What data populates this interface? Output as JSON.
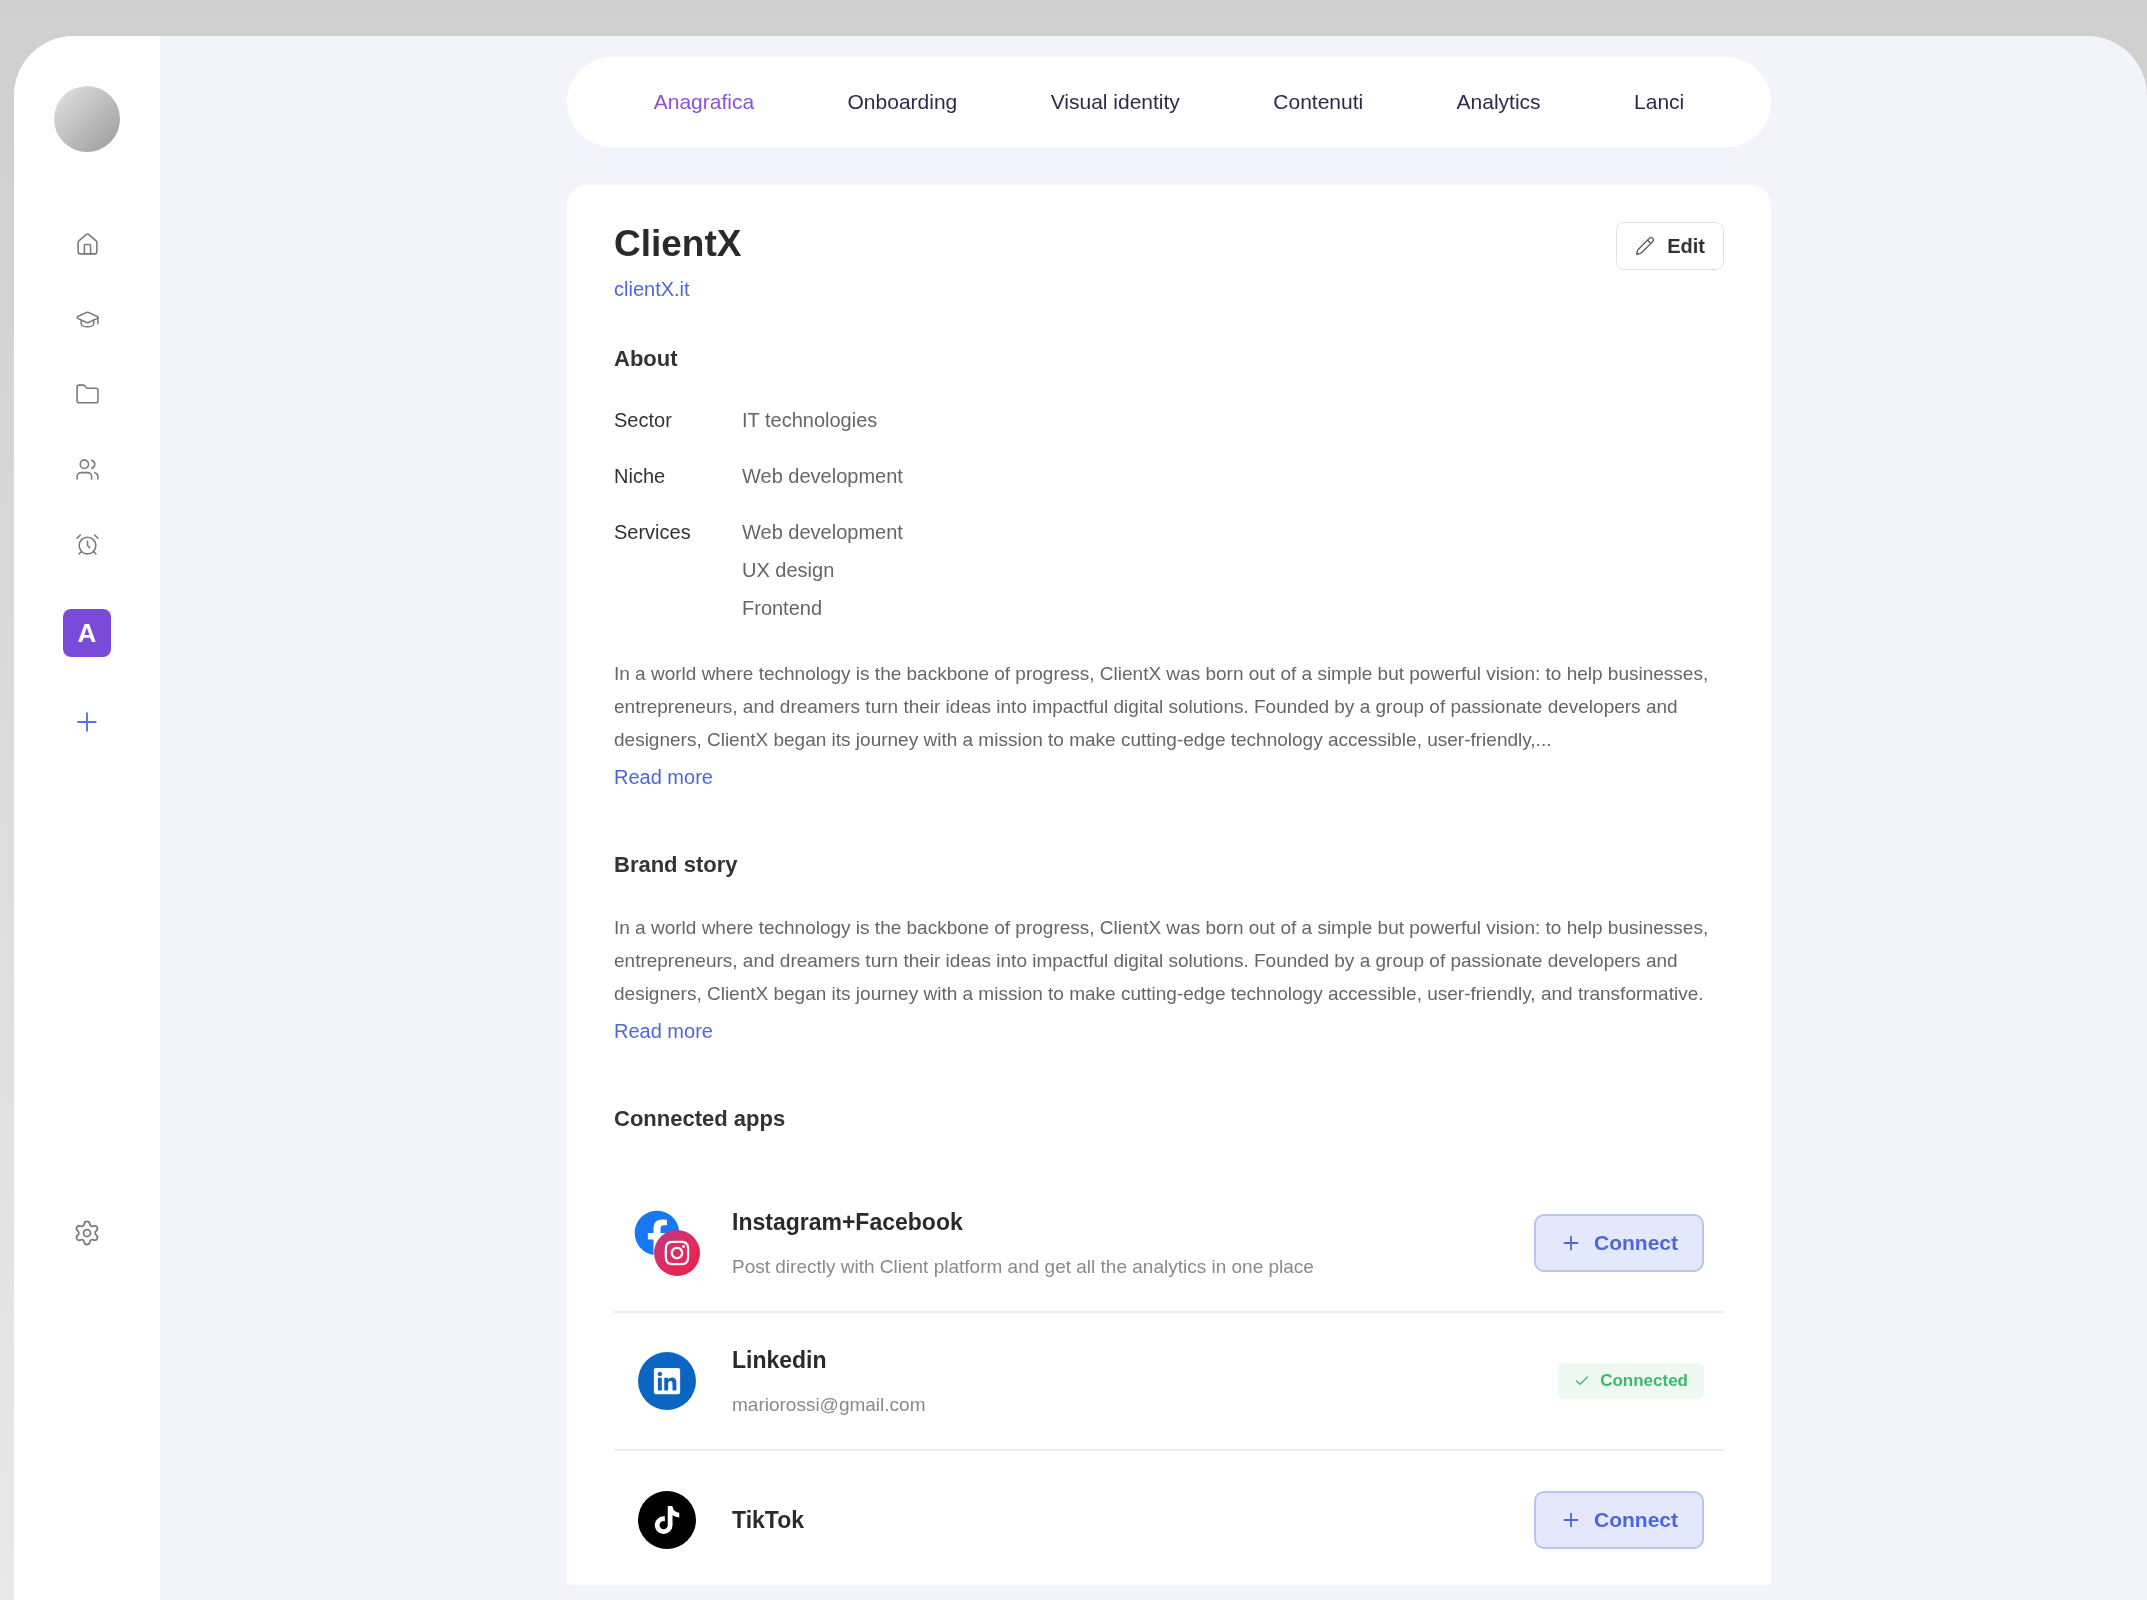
{
  "sidebar": {
    "workspace_badge": "A"
  },
  "tabs": [
    {
      "label": "Anagrafica",
      "selected": true
    },
    {
      "label": "Onboarding",
      "selected": false
    },
    {
      "label": "Visual identity",
      "selected": false
    },
    {
      "label": "Contenuti",
      "selected": false
    },
    {
      "label": "Analytics",
      "selected": false
    },
    {
      "label": "Lanci",
      "selected": false
    }
  ],
  "profile": {
    "name": "ClientX",
    "website": "clientX.it",
    "edit_button": "Edit"
  },
  "about": {
    "heading": "About",
    "fields": [
      {
        "label": "Sector",
        "values": [
          "IT technologies"
        ]
      },
      {
        "label": "Niche",
        "values": [
          "Web development"
        ]
      },
      {
        "label": "Services",
        "values": [
          "Web development",
          "UX design",
          "Frontend"
        ]
      }
    ],
    "description": "In a world where technology is the backbone of progress, ClientX was born out of a simple but powerful vision: to help businesses, entrepreneurs, and dreamers turn their ideas into impactful digital solutions. Founded by a group of passionate developers and designers, ClientX began its journey with a mission to make cutting-edge technology accessible, user-friendly,...",
    "read_more": "Read more"
  },
  "brand_story": {
    "heading": "Brand story",
    "text": "In a world where technology is the backbone of progress, ClientX was born out of a simple but powerful vision: to help businesses, entrepreneurs, and dreamers turn their ideas into impactful digital solutions. Founded by a group of passionate developers and designers, ClientX began its journey with a mission to make cutting-edge technology accessible, user-friendly, and transformative.",
    "read_more": "Read more"
  },
  "connected_apps": {
    "heading": "Connected apps",
    "apps": [
      {
        "name": "Instagram+Facebook",
        "detail": "Post directly with Client platform and get all the analytics in one place",
        "connected": false,
        "action": "Connect"
      },
      {
        "name": "Linkedin",
        "detail": "mariorossi@gmail.com",
        "connected": true,
        "action": "Connected"
      },
      {
        "name": "TikTok",
        "connected": false,
        "action": "Connect"
      }
    ]
  }
}
